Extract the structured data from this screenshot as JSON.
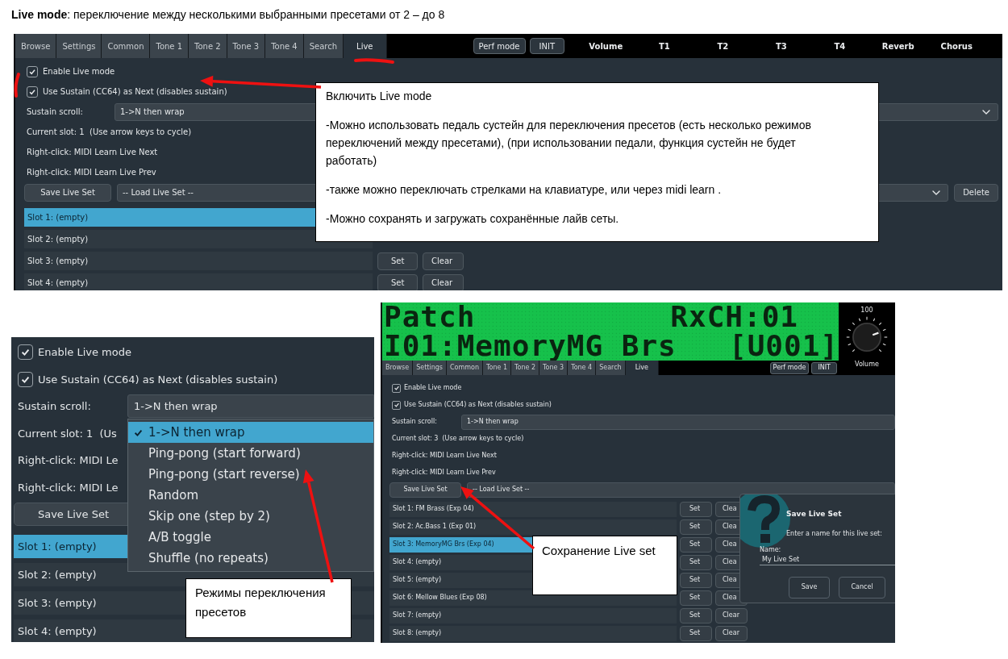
{
  "heading": "**Live mode**: переключение между несколькими выбранными пресетами от 2 – до 8",
  "screenshot_1": {
    "tabs": [
      {
        "label": "Browse",
        "selected": false
      },
      {
        "label": "Settings",
        "selected": false
      },
      {
        "label": "Common",
        "selected": false
      },
      {
        "label": "Tone 1",
        "selected": false
      },
      {
        "label": "Tone 2",
        "selected": false
      },
      {
        "label": "Tone 3",
        "selected": false
      },
      {
        "label": "Tone 4",
        "selected": false
      },
      {
        "label": "Search",
        "selected": false
      },
      {
        "label": "Live",
        "selected": true
      }
    ],
    "header_buttons": [
      "Perf mode",
      "INIT"
    ],
    "header_labels": [
      "Volume",
      "T1",
      "T2",
      "T3",
      "T4",
      "Reverb",
      "Chorus"
    ],
    "checkboxes": [
      {
        "label": "Enable Live mode",
        "checked": true
      },
      {
        "label": "Use Sustain (CC64) as Next (disables sustain)",
        "checked": true
      }
    ],
    "sustain_scroll": {
      "label": "Sustain scroll:",
      "value": "1->N then wrap"
    },
    "info_lines": [
      "Current slot: 1  (Use arrow keys to cycle)",
      "Right-click: MIDI Learn Live Next",
      "Right-click: MIDI Learn Live Prev"
    ],
    "save_button": "Save Live Set",
    "load_select": "-- Load Live Set --",
    "delete_button": "Delete",
    "slots": [
      {
        "label": "Slot 1: (empty)",
        "selected": true
      },
      {
        "label": "Slot 2: (empty)",
        "selected": false
      },
      {
        "label": "Slot 3: (empty)",
        "selected": false,
        "buttons": [
          "Set",
          "Clear"
        ]
      },
      {
        "label": "Slot 4: (empty)",
        "selected": false,
        "buttons": [
          "Set",
          "Clear"
        ]
      }
    ],
    "callout": {
      "paragraphs": [
        "Включить Live mode",
        "-Можно использовать педаль сустейн для переключения пресетов (есть несколько режимов переключений между пресетами), (при использовании педали, функция сустейн не будет работать)",
        "-также можно переключать стрелками на клавиатуре, или через midi learn .",
        "-Можно сохранять и загружать сохранённые лайв сеты."
      ]
    }
  },
  "screenshot_2": {
    "checkboxes": [
      {
        "label": "Enable Live mode",
        "checked": true
      },
      {
        "label": "Use Sustain (CC64) as Next (disables sustain)",
        "checked": true
      }
    ],
    "sustain_scroll": {
      "label": "Sustain scroll:",
      "value": "1->N then wrap"
    },
    "partial_lines": [
      "Current slot: 1  (Us",
      "Right-click: MIDI Le",
      "Right-click: MIDI Le"
    ],
    "save_button": "Save Live Set",
    "menu": [
      {
        "label": "1->N then wrap",
        "selected": true
      },
      {
        "label": "Ping-pong (start forward)",
        "selected": false
      },
      {
        "label": "Ping-pong (start reverse)",
        "selected": false
      },
      {
        "label": "Random",
        "selected": false
      },
      {
        "label": "Skip one (step by 2)",
        "selected": false
      },
      {
        "label": "A/B toggle",
        "selected": false
      },
      {
        "label": "Shuffle (no repeats)",
        "selected": false
      }
    ],
    "slots": [
      {
        "label": "Slot 1: (empty)",
        "selected": true
      },
      {
        "label": "Slot 2: (empty)",
        "selected": false
      },
      {
        "label": "Slot 3: (empty)",
        "selected": false
      },
      {
        "label": "Slot 4: (empty)",
        "selected": false
      }
    ],
    "callout": "Режимы переключения пресетов"
  },
  "screenshot_3": {
    "lcd": [
      [
        "Patch",
        "RxCH:01"
      ],
      [
        "I01:MemoryMG Brs",
        "[U001]"
      ]
    ],
    "volume": {
      "value": "100",
      "label": "Volume"
    },
    "tabs": [
      {
        "label": "Browse",
        "selected": false
      },
      {
        "label": "Settings",
        "selected": false
      },
      {
        "label": "Common",
        "selected": false
      },
      {
        "label": "Tone 1",
        "selected": false
      },
      {
        "label": "Tone 2",
        "selected": false
      },
      {
        "label": "Tone 3",
        "selected": false
      },
      {
        "label": "Tone 4",
        "selected": false
      },
      {
        "label": "Search",
        "selected": false
      },
      {
        "label": "Live",
        "selected": true
      }
    ],
    "header_buttons": [
      "Perf mode",
      "INIT"
    ],
    "checkboxes": [
      {
        "label": "Enable Live mode",
        "checked": true
      },
      {
        "label": "Use Sustain (CC64) as Next (disables sustain)",
        "checked": true
      }
    ],
    "sustain_scroll": {
      "label": "Sustain scroll:",
      "value": "1->N then wrap"
    },
    "info_lines": [
      "Current slot: 3  (Use arrow keys to cycle)",
      "Right-click: MIDI Learn Live Next",
      "Right-click: MIDI Learn Live Prev"
    ],
    "save_button": "Save Live Set",
    "load_select": "-- Load Live Set --",
    "slots": [
      {
        "label": "Slot 1: FM Brass (Exp 04)",
        "selected": false,
        "buttons": [
          "Set",
          "Clea"
        ]
      },
      {
        "label": "Slot 2: Ac.Bass 1 (Exp 01)",
        "selected": false,
        "buttons": [
          "Set",
          "Clea"
        ]
      },
      {
        "label": "Slot 3: MemoryMG Brs (Exp 04)",
        "selected": true,
        "buttons": [
          "Set",
          "Clea"
        ]
      },
      {
        "label": "Slot 4: (empty)",
        "selected": false,
        "buttons": [
          "Set",
          "Clea"
        ]
      },
      {
        "label": "Slot 5: (empty)",
        "selected": false,
        "buttons": [
          "Set",
          "Clea"
        ]
      },
      {
        "label": "Slot 6: Mellow Blues (Exp 08)",
        "selected": false,
        "buttons": [
          "Set",
          "Clea"
        ]
      },
      {
        "label": "Slot 7: (empty)",
        "selected": false,
        "buttons": [
          "Set",
          "Clear"
        ]
      },
      {
        "label": "Slot 8: (empty)",
        "selected": false,
        "buttons": [
          "Set",
          "Clear"
        ]
      }
    ],
    "dialog": {
      "title": "Save Live Set",
      "prompt": "Enter a name for this live set:",
      "field_label": "Name:",
      "value": "My Live Set",
      "buttons": [
        "Save",
        "Cancel"
      ]
    },
    "callout": "Сохранение Live set"
  }
}
